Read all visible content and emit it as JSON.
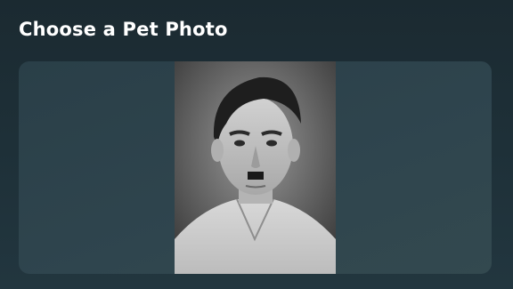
{
  "header": {
    "title": "Choose a Pet Photo"
  },
  "photo": {
    "image_name": "photo-image",
    "description_role": "grayscale portrait photo"
  },
  "colors": {
    "background": "#1e3038",
    "card": "#2f454e",
    "title_text": "#ffffff"
  }
}
